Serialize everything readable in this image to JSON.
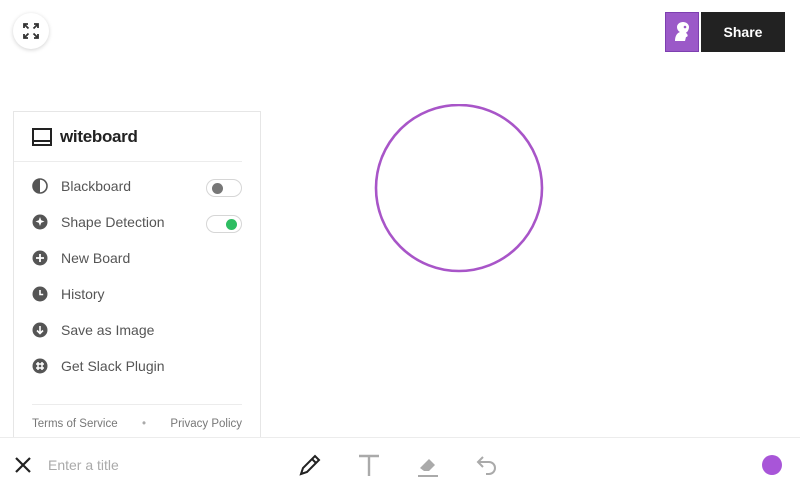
{
  "header": {
    "fullscreen_icon": "expand-icon",
    "avatar_icon": "user-avatar-icon",
    "share_label": "Share"
  },
  "sidebar": {
    "brand": "witeboard",
    "items": [
      {
        "label": "Blackboard",
        "icon": "contrast-icon",
        "toggle": "off"
      },
      {
        "label": "Shape Detection",
        "icon": "shape-detect-icon",
        "toggle": "on"
      },
      {
        "label": "New Board",
        "icon": "plus-circle-icon"
      },
      {
        "label": "History",
        "icon": "clock-icon"
      },
      {
        "label": "Save as Image",
        "icon": "download-icon"
      },
      {
        "label": "Get Slack Plugin",
        "icon": "slack-icon"
      }
    ],
    "footer": {
      "terms": "Terms of Service",
      "separator": "•",
      "privacy": "Privacy Policy"
    }
  },
  "canvas": {
    "stroke_color": "#a855c8"
  },
  "toolbar": {
    "title_placeholder": "Enter a title",
    "tools": [
      "pencil-icon",
      "text-icon",
      "eraser-icon",
      "undo-icon"
    ],
    "active_color": "#a855d8"
  },
  "colors": {
    "accent": "#9b59c8",
    "toggle_on": "#2ebd62",
    "share_bg": "#222222"
  }
}
